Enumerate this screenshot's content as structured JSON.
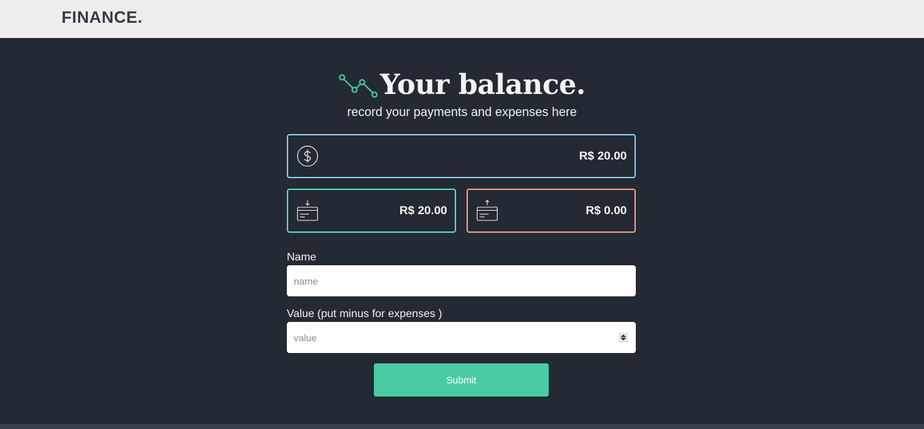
{
  "header": {
    "brand": "FINANCE."
  },
  "hero": {
    "title": "Your balance.",
    "subtitle": "record your payments and expenses here",
    "icon": "line-chart-icon"
  },
  "cards": {
    "total": {
      "amount": "R$ 20.00",
      "icon": "dollar-coin-icon",
      "border_color": "#8ec3ec"
    },
    "income": {
      "amount": "R$ 20.00",
      "icon": "card-download-icon",
      "border_color": "#58d7ba"
    },
    "expense": {
      "amount": "R$ 0.00",
      "icon": "card-upload-icon",
      "border_color": "#ee9a88"
    }
  },
  "form": {
    "name_label": "Name",
    "name_placeholder": "name",
    "value_label": "Value (put minus for expenses )",
    "value_placeholder": "value",
    "submit_label": "Submit"
  },
  "colors": {
    "background": "#232a33",
    "topbar": "#eeeeee",
    "accent": "#4acba4"
  }
}
